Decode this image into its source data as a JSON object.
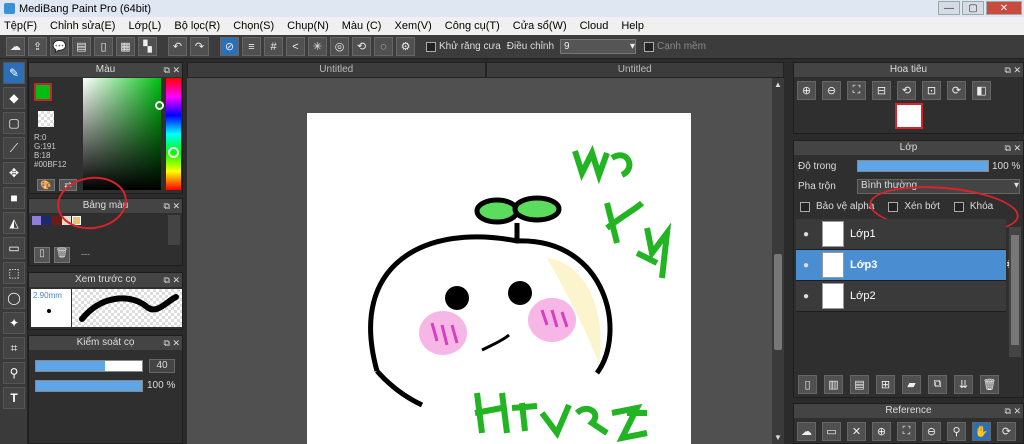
{
  "window": {
    "title": "MediBang Paint Pro (64bit)"
  },
  "menu": [
    "Tệp(F)",
    "Chỉnh sửa(E)",
    "Lớp(L)",
    "Bộ lọc(R)",
    "Chọn(S)",
    "Chụp(N)",
    "Màu (C)",
    "Xem(V)",
    "Công cụ(T)",
    "Cửa sổ(W)",
    "Cloud",
    "Help"
  ],
  "toolbar": {
    "antialias_label": "Khử răng cưa",
    "adjust_label": "Điều chỉnh",
    "adjust_value": "9",
    "soft_edge_label": "Cạnh mềm"
  },
  "panels": {
    "color": {
      "title": "Màu",
      "r": "R:0",
      "g": "G:191",
      "b": "B:18",
      "hex": "#00BF12",
      "fg_color": "#00bf12"
    },
    "palette": {
      "title": "Bảng màu",
      "more": "---"
    },
    "brush_preview": {
      "title": "Xem trước cọ",
      "size": "2.90mm"
    },
    "brush_control": {
      "title": "Kiểm soát cọ",
      "size_value": "40",
      "opacity_value": "100 %"
    },
    "navigator": {
      "title": "Hoa tiêu"
    },
    "layer": {
      "title": "Lớp",
      "opacity_label": "Độ trong",
      "opacity_value": "100 %",
      "blend_label": "Pha trộn",
      "blend_value": "Bình thường",
      "protect_alpha": "Bảo vệ alpha",
      "clipping": "Xén bớt",
      "lock": "Khóa",
      "layers": [
        "Lớp1",
        "Lớp3",
        "Lớp2"
      ]
    },
    "reference": {
      "title": "Reference"
    }
  },
  "tabs": [
    "Untitled",
    "Untitled"
  ],
  "canvas": {
    "text_top": "LUO",
    "text_mid": "KEY",
    "text_bottom": "HTLƆ<7"
  }
}
